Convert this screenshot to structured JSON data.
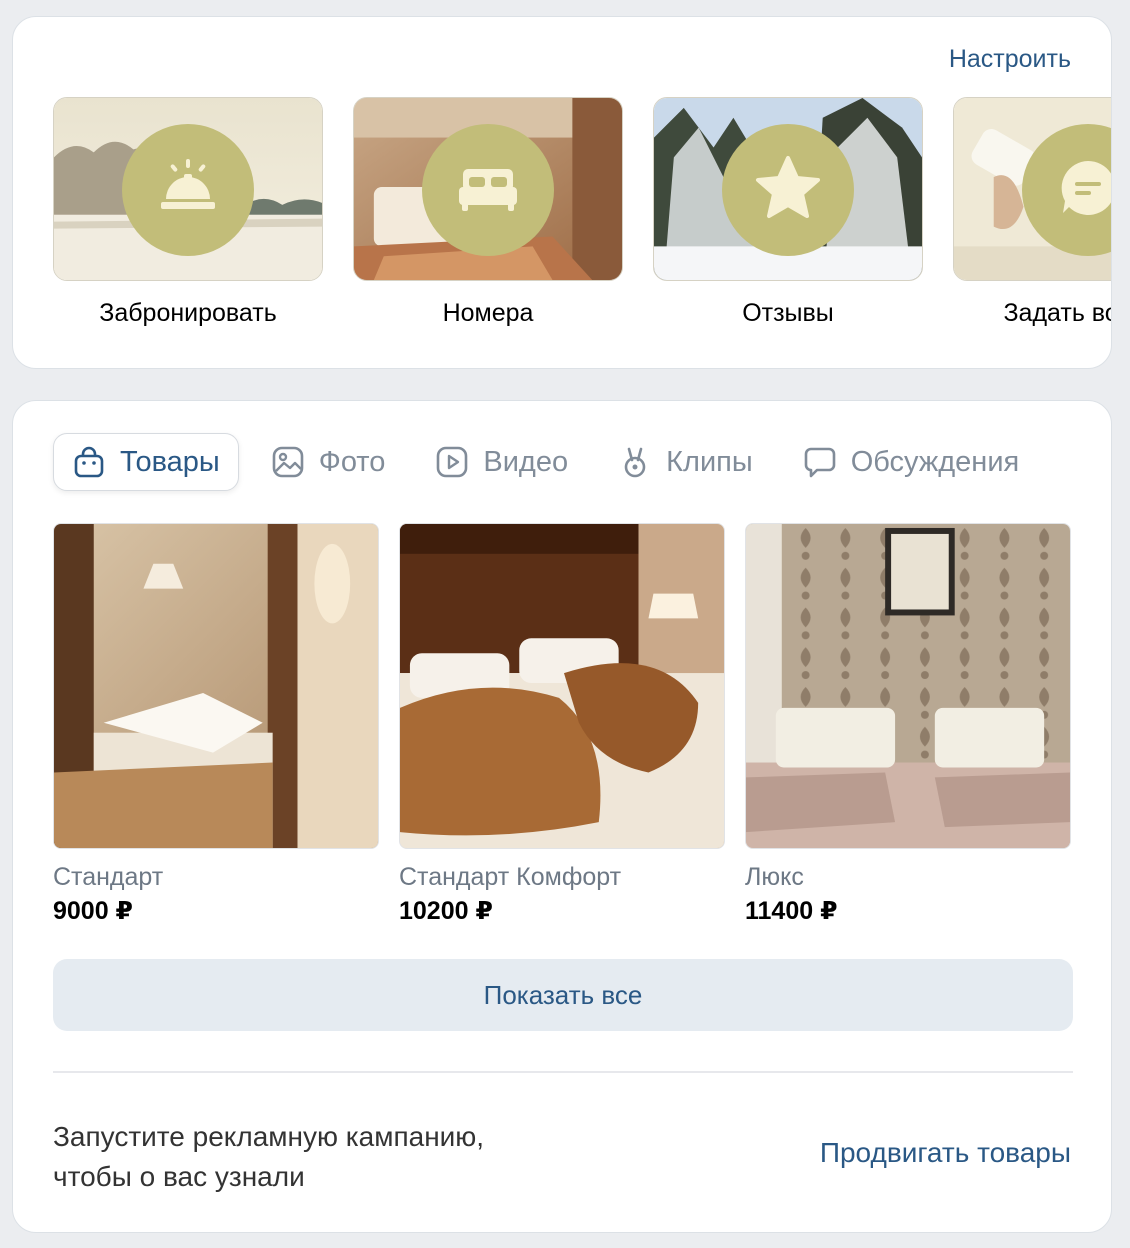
{
  "actions_card": {
    "settings_label": "Настроить",
    "items": [
      {
        "label": "Забронировать",
        "icon": "service-bell-icon"
      },
      {
        "label": "Номера",
        "icon": "bed-icon"
      },
      {
        "label": "Отзывы",
        "icon": "star-icon"
      },
      {
        "label": "Задать вопрос",
        "icon": "message-icon"
      }
    ]
  },
  "goods_card": {
    "tabs": [
      {
        "label": "Товары",
        "icon": "shopping-bag-icon",
        "active": true
      },
      {
        "label": "Фото",
        "icon": "photo-icon",
        "active": false
      },
      {
        "label": "Видео",
        "icon": "video-icon",
        "active": false
      },
      {
        "label": "Клипы",
        "icon": "clips-icon",
        "active": false
      },
      {
        "label": "Обсуждения",
        "icon": "discussion-icon",
        "active": false
      }
    ],
    "products": [
      {
        "title": "Стандарт",
        "price": "9000 ₽"
      },
      {
        "title": "Стандарт Комфорт",
        "price": "10200 ₽"
      },
      {
        "title": "Люкс",
        "price": "11400 ₽"
      }
    ],
    "show_all_label": "Показать все",
    "promo_text_line1": "Запустите рекламную кампанию,",
    "promo_text_line2": "чтобы о вас узнали",
    "promo_link_label": "Продвигать товары"
  },
  "colors": {
    "accent": "#2a5885",
    "action_circle": "#c2bd79",
    "action_icon": "#f7f1d4",
    "button_bg": "#e5ebf1",
    "page_bg": "#ebedf0"
  }
}
